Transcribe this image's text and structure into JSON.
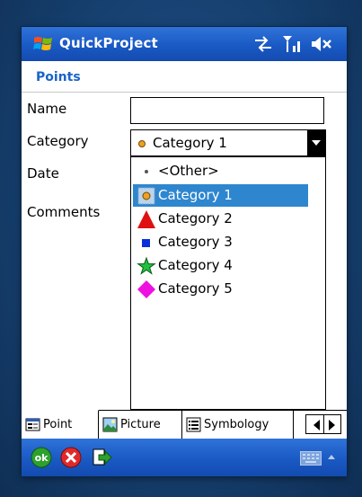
{
  "titlebar": {
    "app_title": "QuickProject",
    "icons": [
      "windows-flag-icon",
      "connectivity-icon",
      "signal-icon",
      "speaker-muted-icon"
    ]
  },
  "page": {
    "heading": "Points"
  },
  "form": {
    "name_label": "Name",
    "name_value": "",
    "category_label": "Category",
    "category_selected": "Category 1",
    "date_label": "Date",
    "comments_label": "Comments"
  },
  "dropdown": {
    "items": [
      {
        "label": "<Other>",
        "icon": "small-dot-icon"
      },
      {
        "label": "Category 1",
        "icon": "orange-circle-icon",
        "selected": true
      },
      {
        "label": "Category 2",
        "icon": "red-triangle-icon"
      },
      {
        "label": "Category 3",
        "icon": "blue-square-icon"
      },
      {
        "label": "Category 4",
        "icon": "green-star-icon"
      },
      {
        "label": "Category 5",
        "icon": "magenta-diamond-icon"
      }
    ]
  },
  "tabs": [
    {
      "label": "Point",
      "icon": "form-icon",
      "active": true
    },
    {
      "label": "Picture",
      "icon": "picture-icon"
    },
    {
      "label": "Symbology",
      "icon": "list-icon"
    }
  ],
  "cmdbar": {
    "buttons": [
      "ok-icon",
      "cancel-icon",
      "export-icon",
      "keyboard-icon"
    ],
    "ok_text": "ok"
  },
  "colors": {
    "accent": "#1a63c8",
    "titlebar": "#1a59c4",
    "selection": "#2e86cf"
  }
}
